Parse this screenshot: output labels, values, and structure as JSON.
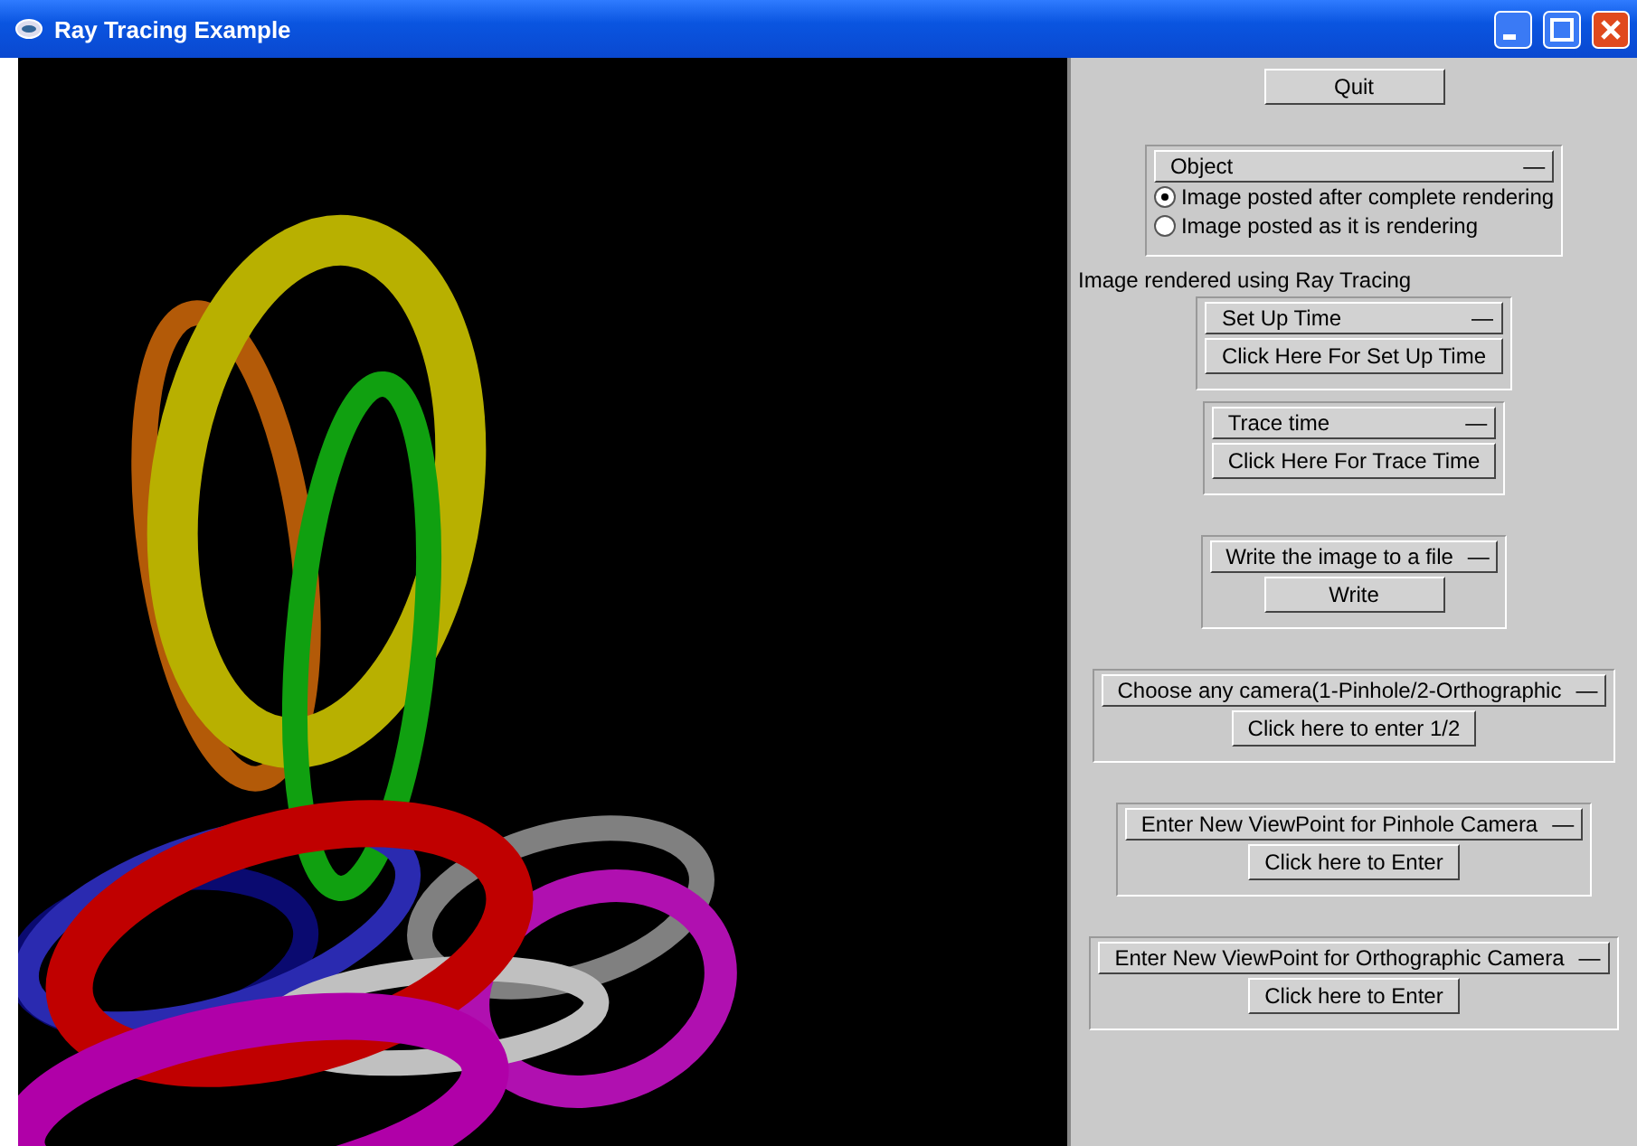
{
  "window": {
    "title": "Ray Tracing Example"
  },
  "panel": {
    "quit_button": "Quit",
    "object_group": {
      "title": "Object",
      "collapse": "—",
      "options": [
        {
          "label": "Image posted after complete rendering",
          "selected": true
        },
        {
          "label": "Image posted as it is rendering",
          "selected": false
        }
      ]
    },
    "status_text": "Image rendered using Ray Tracing",
    "groups": [
      {
        "title": "Set Up Time",
        "collapse": "—",
        "button": "Click Here For Set Up Time"
      },
      {
        "title": "Trace time",
        "collapse": "—",
        "button": "Click Here For Trace Time"
      },
      {
        "title": "Write the image to a file",
        "collapse": "—",
        "button": "Write"
      },
      {
        "title": "Choose any camera(1-Pinhole/2-Orthographic",
        "collapse": "—",
        "button": "Click here to enter 1/2"
      },
      {
        "title": "Enter New ViewPoint for Pinhole Camera",
        "collapse": "—",
        "button": "Click here to Enter"
      },
      {
        "title": "Enter New ViewPoint for Orthographic Camera",
        "collapse": "—",
        "button": "Click here to Enter"
      }
    ]
  }
}
